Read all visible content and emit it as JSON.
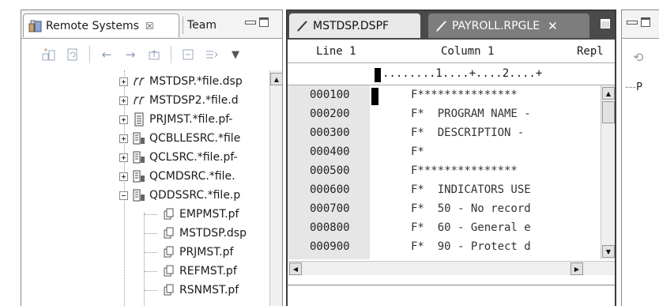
{
  "left_pane": {
    "tab_remote": "Remote Systems",
    "tab_remote_close": "☒",
    "tab_team": "Team"
  },
  "tree": {
    "items": [
      {
        "label": "MSTDSP.*file.dsp",
        "icon": "display-file-icon"
      },
      {
        "label": "MSTDSP2.*file.d",
        "icon": "display-file-icon"
      },
      {
        "label": "PRJMST.*file.pf-",
        "icon": "physical-file-icon"
      },
      {
        "label": "QCBLLESRC.*file",
        "icon": "source-file-icon"
      },
      {
        "label": "QCLSRC.*file.pf-",
        "icon": "source-file-icon"
      },
      {
        "label": "QCMDSRC.*file.",
        "icon": "source-file-icon"
      },
      {
        "label": "QDDSSRC.*file.p",
        "icon": "source-file-icon"
      }
    ],
    "members": [
      "EMPMST.pf",
      "MSTDSP.dsp",
      "PRJMST.pf",
      "REFMST.pf",
      "RSNMST.pf"
    ]
  },
  "editor": {
    "tab1": "MSTDSP.DSPF",
    "tab2": "PAYROLL.RPGLE",
    "tab2_close": "✕",
    "line_label": "Line 1",
    "column_label": "Column 1",
    "mode_label": "Repl",
    "ruler": "........1....+....2....+",
    "lines": [
      {
        "seq": "000100",
        "src": "F***************"
      },
      {
        "seq": "000200",
        "src": "F*  PROGRAM NAME -"
      },
      {
        "seq": "000300",
        "src": "F*  DESCRIPTION -"
      },
      {
        "seq": "000400",
        "src": "F*"
      },
      {
        "seq": "000500",
        "src": "F***************"
      },
      {
        "seq": "000600",
        "src": "F*  INDICATORS USE"
      },
      {
        "seq": "000700",
        "src": "F*  50 - No record"
      },
      {
        "seq": "000800",
        "src": "F*  60 - General e"
      },
      {
        "seq": "000900",
        "src": "F*  90 - Protect d"
      }
    ]
  },
  "right_pane": {
    "text": "P"
  }
}
